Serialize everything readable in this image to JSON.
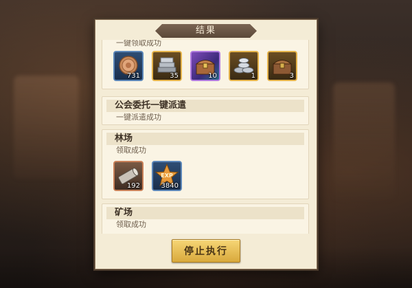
{
  "dialog": {
    "title": "结果",
    "stop_button": "停止执行"
  },
  "sections": [
    {
      "header": "",
      "status": "一键领取成功",
      "items": [
        {
          "icon": "coin-icon",
          "rarity": "blue",
          "count": "731"
        },
        {
          "icon": "silver-ingots-icon",
          "rarity": "gold",
          "count": "35"
        },
        {
          "icon": "treasure-chest-icon",
          "rarity": "purple",
          "count": "10"
        },
        {
          "icon": "silver-coins-pile-icon",
          "rarity": "gold",
          "count": "1"
        },
        {
          "icon": "treasure-chest-icon",
          "rarity": "gold",
          "count": "3"
        }
      ]
    },
    {
      "header": "公会委托一键派遣",
      "status": "一键派遣成功",
      "items": []
    },
    {
      "header": "林场",
      "status": "领取成功",
      "items": [
        {
          "icon": "wood-log-icon",
          "rarity": "red",
          "count": "192"
        },
        {
          "icon": "exp-star-icon",
          "rarity": "blue",
          "count": "3840",
          "label": "EXP"
        }
      ]
    },
    {
      "header": "矿场",
      "status": "领取成功",
      "items": []
    }
  ]
}
